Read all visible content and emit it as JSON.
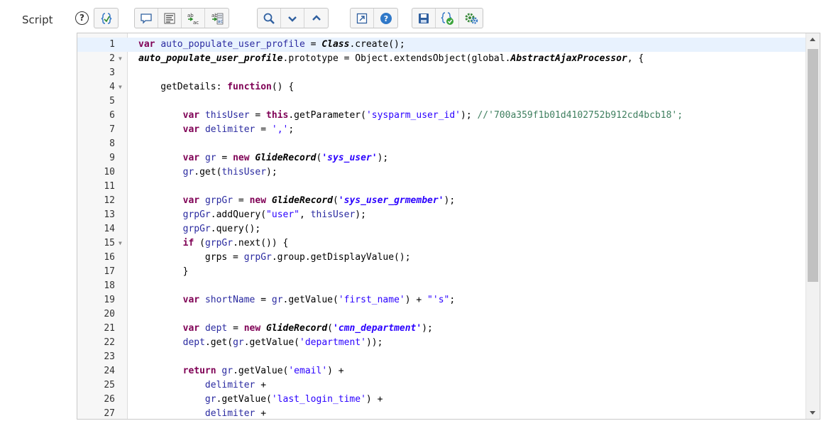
{
  "field": {
    "label": "Script",
    "help": "?"
  },
  "toolbar": {
    "groups": [
      [
        "format-code-icon"
      ],
      [
        "comment-icon",
        "format-align-icon",
        "replace-icon",
        "replace-all-icon"
      ],
      [
        "search-icon",
        "search-next-icon",
        "search-previous-icon"
      ],
      [
        "fullscreen-icon",
        "help-icon"
      ],
      [
        "save-icon",
        "check-script-icon",
        "debug-settings-icon"
      ]
    ]
  },
  "editor": {
    "active_line": 1,
    "fold_lines": [
      2,
      4,
      15
    ],
    "lines": [
      [
        [
          "k",
          "var"
        ],
        [
          "t",
          " "
        ],
        [
          "v",
          "auto_populate_user_profile"
        ],
        [
          "t",
          " = "
        ],
        [
          "ci",
          "Class"
        ],
        [
          "t",
          ".create();"
        ]
      ],
      [
        [
          "ci",
          "auto_populate_user_profile"
        ],
        [
          "t",
          ".prototype = Object.extendsObject(global."
        ],
        [
          "ci",
          "AbstractAjaxProcessor"
        ],
        [
          "t",
          ", {"
        ]
      ],
      [],
      [
        [
          "t",
          "    getDetails: "
        ],
        [
          "k",
          "function"
        ],
        [
          "t",
          "() {"
        ]
      ],
      [],
      [
        [
          "t",
          "        "
        ],
        [
          "k",
          "var"
        ],
        [
          "t",
          " "
        ],
        [
          "v",
          "thisUser"
        ],
        [
          "t",
          " = "
        ],
        [
          "k",
          "this"
        ],
        [
          "t",
          ".getParameter("
        ],
        [
          "s",
          "'sysparm_user_id'"
        ],
        [
          "t",
          "); "
        ],
        [
          "cm",
          "//'700a359f1b01d4102752b912cd4bcb18';"
        ]
      ],
      [
        [
          "t",
          "        "
        ],
        [
          "k",
          "var"
        ],
        [
          "t",
          " "
        ],
        [
          "v",
          "delimiter"
        ],
        [
          "t",
          " = "
        ],
        [
          "s",
          "','"
        ],
        [
          "t",
          ";"
        ]
      ],
      [],
      [
        [
          "t",
          "        "
        ],
        [
          "k",
          "var"
        ],
        [
          "t",
          " "
        ],
        [
          "v",
          "gr"
        ],
        [
          "t",
          " = "
        ],
        [
          "k",
          "new"
        ],
        [
          "t",
          " "
        ],
        [
          "ci",
          "GlideRecord"
        ],
        [
          "t",
          "("
        ],
        [
          "si",
          "'sys_user'"
        ],
        [
          "t",
          ");"
        ]
      ],
      [
        [
          "t",
          "        "
        ],
        [
          "v",
          "gr"
        ],
        [
          "t",
          ".get("
        ],
        [
          "v",
          "thisUser"
        ],
        [
          "t",
          ");"
        ]
      ],
      [],
      [
        [
          "t",
          "        "
        ],
        [
          "k",
          "var"
        ],
        [
          "t",
          " "
        ],
        [
          "v",
          "grpGr"
        ],
        [
          "t",
          " = "
        ],
        [
          "k",
          "new"
        ],
        [
          "t",
          " "
        ],
        [
          "ci",
          "GlideRecord"
        ],
        [
          "t",
          "("
        ],
        [
          "si",
          "'sys_user_grmember'"
        ],
        [
          "t",
          ");"
        ]
      ],
      [
        [
          "t",
          "        "
        ],
        [
          "v",
          "grpGr"
        ],
        [
          "t",
          ".addQuery("
        ],
        [
          "s",
          "\"user\""
        ],
        [
          "t",
          ", "
        ],
        [
          "v",
          "thisUser"
        ],
        [
          "t",
          ");"
        ]
      ],
      [
        [
          "t",
          "        "
        ],
        [
          "v",
          "grpGr"
        ],
        [
          "t",
          ".query();"
        ]
      ],
      [
        [
          "t",
          "        "
        ],
        [
          "k",
          "if"
        ],
        [
          "t",
          " ("
        ],
        [
          "v",
          "grpGr"
        ],
        [
          "t",
          ".next()) {"
        ]
      ],
      [
        [
          "t",
          "            grps = "
        ],
        [
          "v",
          "grpGr"
        ],
        [
          "t",
          ".group.getDisplayValue();"
        ]
      ],
      [
        [
          "t",
          "        }"
        ]
      ],
      [],
      [
        [
          "t",
          "        "
        ],
        [
          "k",
          "var"
        ],
        [
          "t",
          " "
        ],
        [
          "v",
          "shortName"
        ],
        [
          "t",
          " = "
        ],
        [
          "v",
          "gr"
        ],
        [
          "t",
          ".getValue("
        ],
        [
          "s",
          "'first_name'"
        ],
        [
          "t",
          ") + "
        ],
        [
          "s",
          "\"'s\""
        ],
        [
          "t",
          ";"
        ]
      ],
      [],
      [
        [
          "t",
          "        "
        ],
        [
          "k",
          "var"
        ],
        [
          "t",
          " "
        ],
        [
          "v",
          "dept"
        ],
        [
          "t",
          " = "
        ],
        [
          "k",
          "new"
        ],
        [
          "t",
          " "
        ],
        [
          "ci",
          "GlideRecord"
        ],
        [
          "t",
          "("
        ],
        [
          "si",
          "'cmn_department'"
        ],
        [
          "t",
          ");"
        ]
      ],
      [
        [
          "t",
          "        "
        ],
        [
          "v",
          "dept"
        ],
        [
          "t",
          ".get("
        ],
        [
          "v",
          "gr"
        ],
        [
          "t",
          ".getValue("
        ],
        [
          "s",
          "'department'"
        ],
        [
          "t",
          "));"
        ]
      ],
      [],
      [
        [
          "t",
          "        "
        ],
        [
          "k",
          "return"
        ],
        [
          "t",
          " "
        ],
        [
          "v",
          "gr"
        ],
        [
          "t",
          ".getValue("
        ],
        [
          "s",
          "'email'"
        ],
        [
          "t",
          ") +"
        ]
      ],
      [
        [
          "t",
          "            "
        ],
        [
          "v",
          "delimiter"
        ],
        [
          "t",
          " +"
        ]
      ],
      [
        [
          "t",
          "            "
        ],
        [
          "v",
          "gr"
        ],
        [
          "t",
          ".getValue("
        ],
        [
          "s",
          "'last_login_time'"
        ],
        [
          "t",
          ") +"
        ]
      ],
      [
        [
          "t",
          "            "
        ],
        [
          "v",
          "delimiter"
        ],
        [
          "t",
          " +"
        ]
      ]
    ]
  }
}
